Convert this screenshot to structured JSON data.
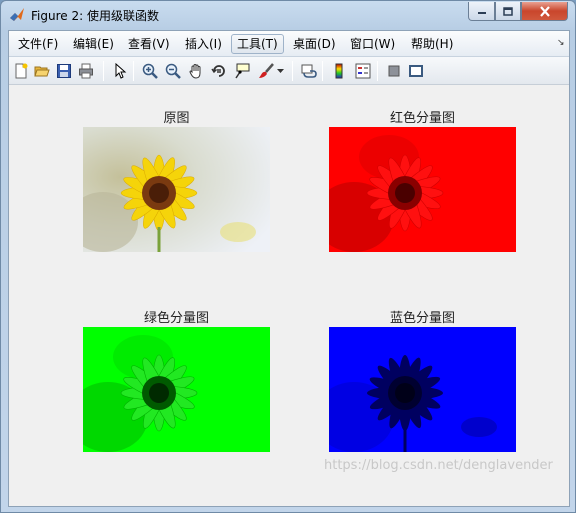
{
  "window": {
    "title": "Figure 2: 使用级联函数"
  },
  "menu": {
    "items": [
      "文件(F)",
      "编辑(E)",
      "查看(V)",
      "插入(I)",
      "工具(T)",
      "桌面(D)",
      "窗口(W)",
      "帮助(H)"
    ],
    "active_index": 4
  },
  "toolbar": {
    "icons": [
      "new-figure-icon",
      "open-file-icon",
      "save-icon",
      "print-icon",
      "pointer-icon",
      "zoom-in-icon",
      "zoom-out-icon",
      "pan-hand-icon",
      "rotate-3d-icon",
      "data-cursor-icon",
      "brush-icon",
      "link-plot-icon",
      "colorbar-icon",
      "legend-icon",
      "hide-plot-tools-icon",
      "show-plot-tools-icon"
    ]
  },
  "subplots": [
    {
      "title": "原图",
      "channel": "original"
    },
    {
      "title": "红色分量图",
      "channel": "red",
      "color": "#ff0000"
    },
    {
      "title": "绿色分量图",
      "channel": "green",
      "color": "#00ff00"
    },
    {
      "title": "蓝色分量图",
      "channel": "blue",
      "color": "#0000ff"
    }
  ],
  "watermark": "https://blog.csdn.net/denglavender"
}
